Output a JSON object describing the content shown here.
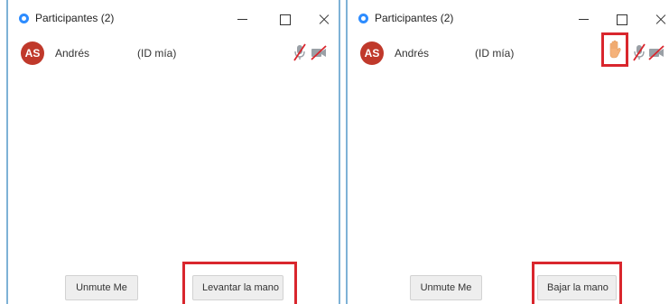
{
  "colors": {
    "window_border": "#7eb2d6",
    "app_icon": "#2d8cff",
    "avatar_bg": "#c0392b",
    "muted_red": "#d9262d",
    "highlight_frame": "#d9262d",
    "hand_icon": "#f5b27a",
    "button_bg": "#eeeeee"
  },
  "left_window": {
    "title": "Participantes (2)",
    "participant": {
      "initials": "AS",
      "name": "Andrés",
      "id_label": "(ID mía)",
      "icons": [
        "mic-muted-icon",
        "video-off-icon"
      ]
    },
    "buttons": {
      "unmute": "Unmute Me",
      "hand": "Levantar la mano"
    }
  },
  "right_window": {
    "title": "Participantes (2)",
    "participant": {
      "initials": "AS",
      "name": "Andrés",
      "id_label": "(ID mía)",
      "icons": [
        "raised-hand-icon",
        "mic-muted-icon",
        "video-off-icon"
      ]
    },
    "buttons": {
      "unmute": "Unmute Me",
      "hand": "Bajar la mano"
    }
  }
}
